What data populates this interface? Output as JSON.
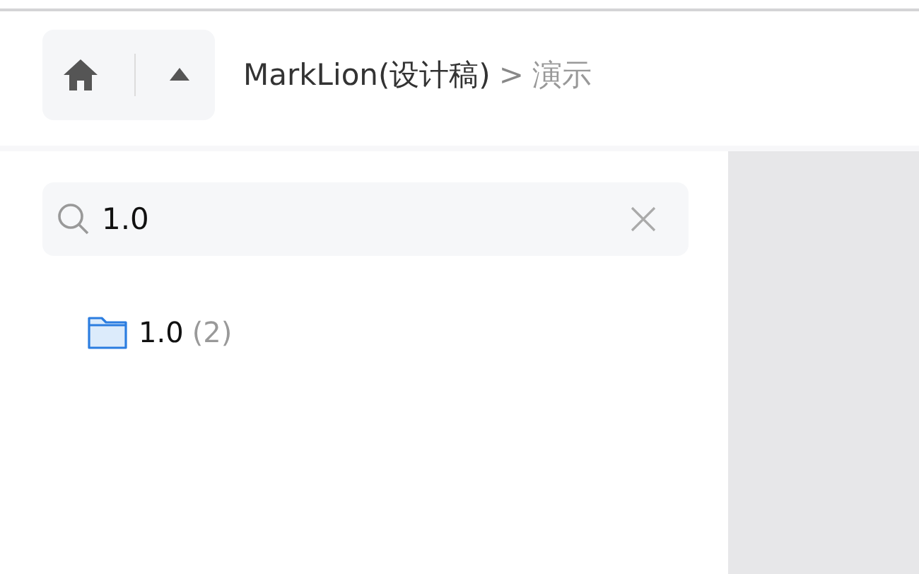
{
  "breadcrumb": [
    {
      "label": "MarkLion(设计稿)",
      "current": false
    },
    {
      "label": "演示",
      "current": true
    }
  ],
  "breadcrumb_separator": ">",
  "search": {
    "value": "1.0"
  },
  "results": [
    {
      "label": "1.0",
      "count": "(2)"
    }
  ]
}
